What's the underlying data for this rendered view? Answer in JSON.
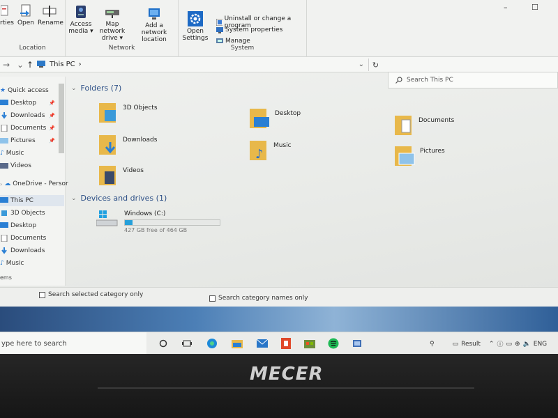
{
  "ribbon": {
    "location_group": {
      "title": "Location",
      "buttons": [
        {
          "label": "rties"
        },
        {
          "label": "Open"
        },
        {
          "label": "Rename"
        }
      ]
    },
    "network_group": {
      "title": "Network",
      "buttons": [
        {
          "line1": "Access",
          "line2": "media ▾"
        },
        {
          "line1": "Map network",
          "line2": "drive ▾"
        },
        {
          "line1": "Add a network",
          "line2": "location"
        }
      ]
    },
    "system_group": {
      "title": "System",
      "open_settings": {
        "line1": "Open",
        "line2": "Settings"
      },
      "items": [
        {
          "label": "Uninstall or change a program"
        },
        {
          "label": "System properties"
        },
        {
          "label": "Manage"
        }
      ]
    },
    "window_controls": {
      "minimize": "–",
      "maximize": "☐"
    }
  },
  "address_bar": {
    "path": "This PC",
    "separator": "›",
    "refresh": "↻",
    "dropdown": "⌄"
  },
  "search": {
    "placeholder": "Search This PC"
  },
  "sidebar": {
    "quick_access": "Quick access",
    "quick_items": [
      {
        "label": "Desktop",
        "pinned": true
      },
      {
        "label": "Downloads",
        "pinned": true
      },
      {
        "label": "Documents",
        "pinned": true
      },
      {
        "label": "Pictures",
        "pinned": true
      },
      {
        "label": "Music",
        "pinned": false
      },
      {
        "label": "Videos",
        "pinned": false
      }
    ],
    "onedrive": "OneDrive - Persor",
    "this_pc": "This PC",
    "pc_items": [
      {
        "label": "3D Objects"
      },
      {
        "label": "Desktop"
      },
      {
        "label": "Documents"
      },
      {
        "label": "Downloads"
      },
      {
        "label": "Music"
      }
    ],
    "items_count": "ems"
  },
  "folders": {
    "header": "Folders (7)",
    "items": [
      {
        "label": "3D Objects"
      },
      {
        "label": "Desktop"
      },
      {
        "label": "Documents"
      },
      {
        "label": "Downloads"
      },
      {
        "label": "Music"
      },
      {
        "label": "Pictures"
      },
      {
        "label": "Videos"
      }
    ]
  },
  "drives": {
    "header": "Devices and drives (1)",
    "items": [
      {
        "name": "Windows (C:)",
        "free_text": "427 GB free of 464 GB",
        "used_fraction": 0.08
      }
    ]
  },
  "control_panel_strip": {
    "check1": "Search selected category only",
    "check2": "Search category names only"
  },
  "taskbar": {
    "search_text": "ype here to search",
    "tray_result": "Result",
    "tray_lang": "ENG"
  },
  "brand": {
    "name": "MECER"
  },
  "colors": {
    "accent_blue": "#2c4f86",
    "drive_fill": "#26a0da",
    "folder_yellow": "#e8b84a"
  }
}
